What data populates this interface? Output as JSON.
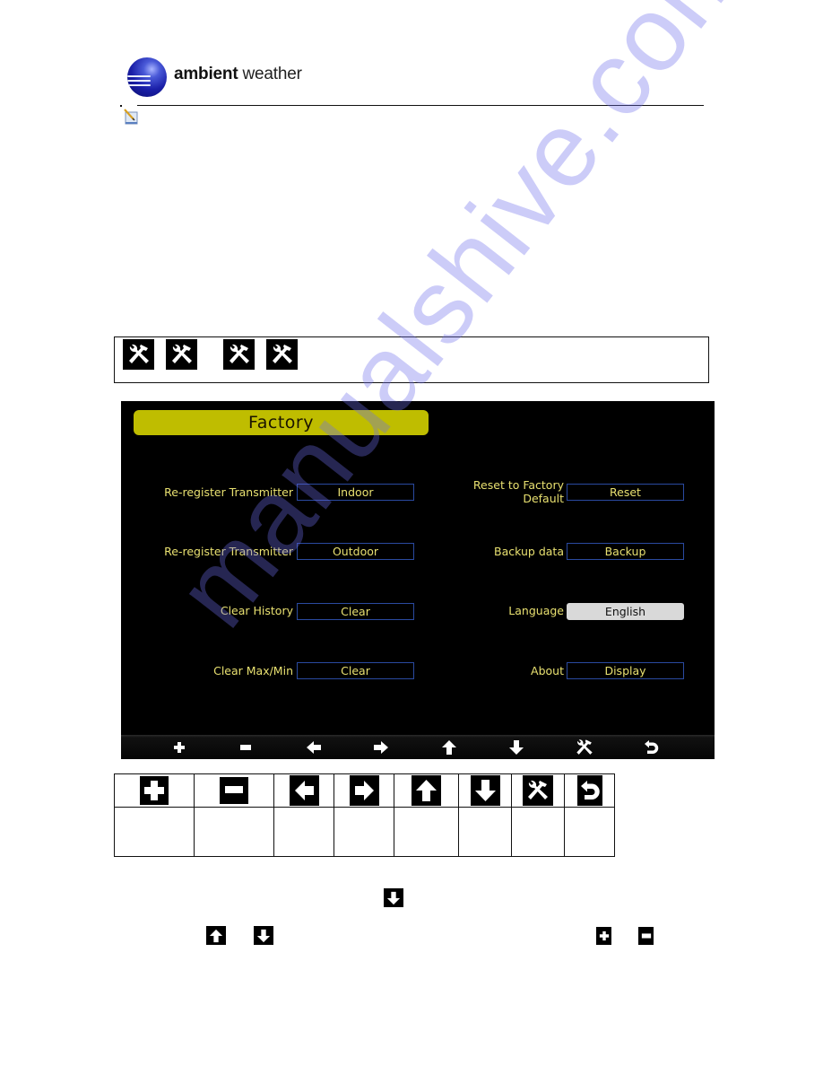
{
  "header": {
    "brand_bold": "ambient",
    "brand_light": " weather",
    "logo": "ambient-weather-globe-logo",
    "note_icon": "note-pencil-icon"
  },
  "watermark": "manualshive.com",
  "tool_box": {
    "icons": [
      "tools-icon",
      "tools-icon",
      "tools-icon",
      "tools-icon"
    ]
  },
  "screen": {
    "title": "Factory",
    "colors": {
      "title_bar": "#bfbd00",
      "label": "#e8e070",
      "field_border": "#2a4aa0",
      "selected_field": "#d9d9d9"
    },
    "left": [
      {
        "label": "Re-register Transmitter",
        "value": "Indoor"
      },
      {
        "label": "Re-register Transmitter",
        "value": "Outdoor"
      },
      {
        "label": "Clear History",
        "value": "Clear"
      },
      {
        "label": "Clear Max/Min",
        "value": "Clear"
      }
    ],
    "right": [
      {
        "label_line1": "Reset to Factory",
        "label_line2": "Default",
        "value": "Reset"
      },
      {
        "label": "Backup data",
        "value": "Backup"
      },
      {
        "label": "Language",
        "value": "English",
        "selected": true
      },
      {
        "label": "About",
        "value": "Display"
      }
    ],
    "nav_icons": [
      "plus-icon",
      "minus-icon",
      "arrow-left-icon",
      "arrow-right-icon",
      "arrow-up-icon",
      "arrow-down-icon",
      "tools-icon",
      "return-icon"
    ]
  },
  "key_table": {
    "icons": [
      "plus-icon",
      "minus-icon",
      "arrow-left-icon",
      "arrow-right-icon",
      "arrow-up-icon",
      "arrow-down-icon",
      "tools-icon",
      "return-icon"
    ],
    "descriptions": [
      "",
      "",
      "",
      "",
      "",
      "",
      "",
      ""
    ]
  },
  "body_inline_icons": [
    "arrow-down-icon",
    "arrow-up-icon",
    "arrow-down-icon",
    "plus-icon",
    "minus-icon"
  ]
}
